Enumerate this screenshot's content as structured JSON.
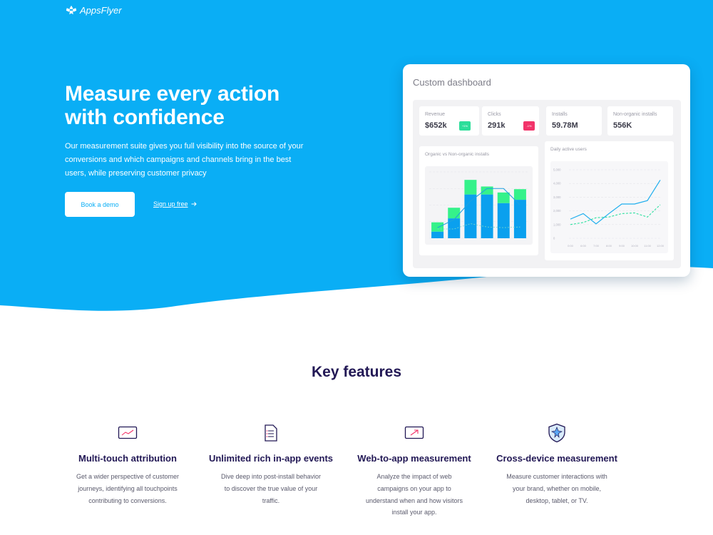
{
  "brand": {
    "name": "AppsFlyer",
    "logo_icon": "appsflyer-logo-icon"
  },
  "colors": {
    "hero_bg": "#0aaef5",
    "dark_text": "#221855",
    "accent_green": "#35f28a",
    "accent_blue": "#0aa0ee",
    "badge_green": "#2dde9a",
    "badge_red": "#f2346a"
  },
  "hero": {
    "title": "Measure every action with confidence",
    "description": "Our measurement suite gives you full visibility into the source of your conversions and which campaigns and channels bring in the best users, while preserving customer privacy",
    "primary_button": "Book a demo",
    "secondary_link": "Sign up free",
    "secondary_link_icon": "arrow-right-icon"
  },
  "dashboard": {
    "title": "Custom dashboard",
    "kpis": [
      {
        "label": "Revenue",
        "value": "$652k",
        "badge": "+1%"
      },
      {
        "label": "Clicks",
        "value": "291k",
        "badge": "-1%"
      },
      {
        "label": "Installs",
        "value": "59.78M"
      },
      {
        "label": "Non-organic installs",
        "value": "556K"
      }
    ],
    "organic_panel_title": "Organic vs Non-organic installs",
    "dau_panel_title": "Daily active users"
  },
  "chart_data": [
    {
      "type": "bar",
      "title": "Organic vs Non-organic installs",
      "categories": [
        "1",
        "2",
        "3",
        "4",
        "5",
        "6"
      ],
      "series": [
        {
          "values": [
            10,
            30,
            66,
            66,
            53,
            58
          ]
        },
        {
          "values": [
            14,
            16,
            22,
            12,
            16,
            16
          ]
        }
      ],
      "ylim": [
        0,
        100
      ],
      "overlay_lines": [
        {
          "values": [
            16,
            28,
            56,
            75,
            75,
            50
          ]
        },
        {
          "values": [
            14,
            14,
            22,
            17,
            16,
            17
          ]
        }
      ]
    },
    {
      "type": "line",
      "title": "Daily active users",
      "x": [
        "0:00",
        "6:00",
        "7:00",
        "8:00",
        "9:00",
        "10:00",
        "11:00",
        "12:00"
      ],
      "yticks": [
        "0",
        "1,000",
        "2,000",
        "3,000",
        "4,000",
        "5,000"
      ],
      "ylim": [
        0,
        5000
      ],
      "series": [
        {
          "values": [
            1400,
            1800,
            1050,
            1800,
            2500,
            2500,
            2750,
            4250
          ]
        },
        {
          "values": [
            1000,
            1150,
            1500,
            1550,
            1800,
            1850,
            1550,
            2450
          ]
        }
      ]
    }
  ],
  "features": {
    "title": "Key features",
    "items": [
      {
        "icon": "chart-screen-icon",
        "title": "Multi-touch attribution",
        "description": "Get a wider perspective of customer journeys, identifying all touchpoints contributing to conversions."
      },
      {
        "icon": "document-list-icon",
        "title": "Unlimited rich in-app events",
        "description": "Dive deep into post-install behavior to discover the true value of your traffic."
      },
      {
        "icon": "web-to-app-icon",
        "title": "Web-to-app measurement",
        "description": "Analyze the impact of web campaigns on your app to understand when and how visitors install your app."
      },
      {
        "icon": "shield-icon",
        "title": "Cross-device measurement",
        "description": "Measure customer interactions with your brand, whether on mobile, desktop, tablet, or TV."
      }
    ]
  }
}
